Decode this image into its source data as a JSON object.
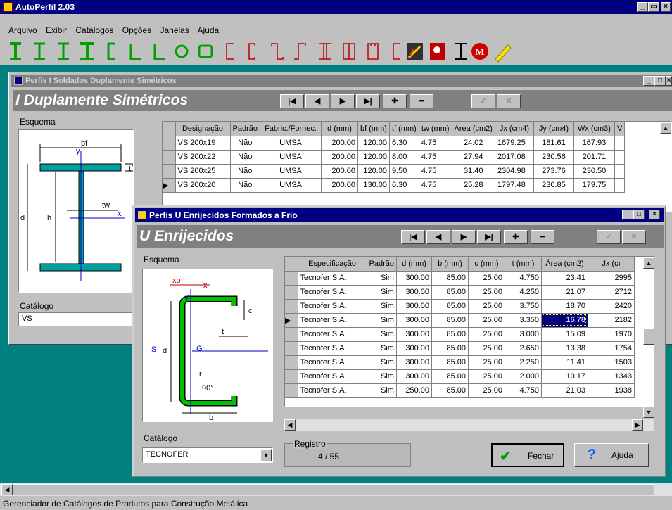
{
  "app": {
    "title": "AutoPerfil 2.03",
    "menu": [
      "Arquivo",
      "Exibir",
      "Catálogos",
      "Opções",
      "Janelas",
      "Ajuda"
    ],
    "status_text": "Gerenciador de Catálogos de Produtos para Construção Metálica"
  },
  "win1": {
    "title": "Perfis I Soldados Duplamente Simétricos",
    "heading": "I Duplamente Simétricos",
    "esquema_label": "Esquema",
    "catalogo_label": "Catálogo",
    "catalogo_value": "VS",
    "columns": [
      "Designação",
      "Padrão",
      "Fabric./Fornec.",
      "d (mm)",
      "bf (mm)",
      "tf (mm)",
      "tw (mm)",
      "Área (cm2)",
      "Jx (cm4)",
      "Jy (cm4)",
      "Wx (cm3)",
      "V"
    ],
    "rows": [
      [
        "VS 200x19",
        "Não",
        "UMSA",
        "200.00",
        "120.00",
        "6.30",
        "4.75",
        "24.02",
        "1679.25",
        "181.61",
        "167.93"
      ],
      [
        "VS 200x22",
        "Não",
        "UMSA",
        "200.00",
        "120.00",
        "8.00",
        "4.75",
        "27.94",
        "2017.08",
        "230.56",
        "201.71"
      ],
      [
        "VS 200x25",
        "Não",
        "UMSA",
        "200.00",
        "120.00",
        "9.50",
        "4.75",
        "31.40",
        "2304.98",
        "273.76",
        "230.50"
      ],
      [
        "VS 200x20",
        "Não",
        "UMSA",
        "200.00",
        "130.00",
        "6.30",
        "4.75",
        "25.28",
        "1797.48",
        "230.85",
        "179.75"
      ]
    ],
    "diagram": {
      "bf": "bf",
      "y": "y",
      "tf": "tf",
      "d": "d",
      "h": "h",
      "tw": "tw",
      "x": "x"
    }
  },
  "win2": {
    "title": "Perfis U Enrijecidos Formados a Frio",
    "heading": "U Enrijecidos",
    "esquema_label": "Esquema",
    "catalogo_label": "Catálogo",
    "catalogo_value": "TECNOFER",
    "registro_label": "Registro",
    "registro_value": "4 / 55",
    "fechar_label": "Fechar",
    "ajuda_label": "Ajuda",
    "columns": [
      "Especificação",
      "Padrão",
      "d (mm)",
      "b (mm)",
      "c (mm)",
      "t (mm)",
      "Área (cm2)",
      "Jx (cı"
    ],
    "rows": [
      [
        "Tecnofer S.A.",
        "Sim",
        "300.00",
        "85.00",
        "25.00",
        "4.750",
        "23.41",
        "2995"
      ],
      [
        "Tecnofer S.A.",
        "Sim",
        "300.00",
        "85.00",
        "25.00",
        "4.250",
        "21.07",
        "2712"
      ],
      [
        "Tecnofer S.A.",
        "Sim",
        "300.00",
        "85.00",
        "25.00",
        "3.750",
        "18.70",
        "2420"
      ],
      [
        "Tecnofer S.A.",
        "Sim",
        "300.00",
        "85.00",
        "25.00",
        "3.350",
        "16.78",
        "2182"
      ],
      [
        "Tecnofer S.A.",
        "Sim",
        "300.00",
        "85.00",
        "25.00",
        "3.000",
        "15.09",
        "1970"
      ],
      [
        "Tecnofer S.A.",
        "Sim",
        "300.00",
        "85.00",
        "25.00",
        "2.650",
        "13.38",
        "1754"
      ],
      [
        "Tecnofer S.A.",
        "Sim",
        "300.00",
        "85.00",
        "25.00",
        "2.250",
        "11.41",
        "1503"
      ],
      [
        "Tecnofer S.A.",
        "Sim",
        "300.00",
        "85.00",
        "25.00",
        "2.000",
        "10.17",
        "1343"
      ],
      [
        "Tecnofer S.A.",
        "Sim",
        "250.00",
        "85.00",
        "25.00",
        "4.750",
        "21.03",
        "1938"
      ]
    ],
    "diagram": {
      "xo": "xo",
      "x": "x",
      "y": "y",
      "c": "c",
      "t": "t",
      "s": "S",
      "d": "d",
      "g": "G",
      "r": "r",
      "angle": "90°",
      "b": "b"
    }
  },
  "colors": {
    "teal": "#008080",
    "title_blue": "#000080",
    "section_green": "#00a000",
    "profile_fill": "#00a0a0"
  }
}
